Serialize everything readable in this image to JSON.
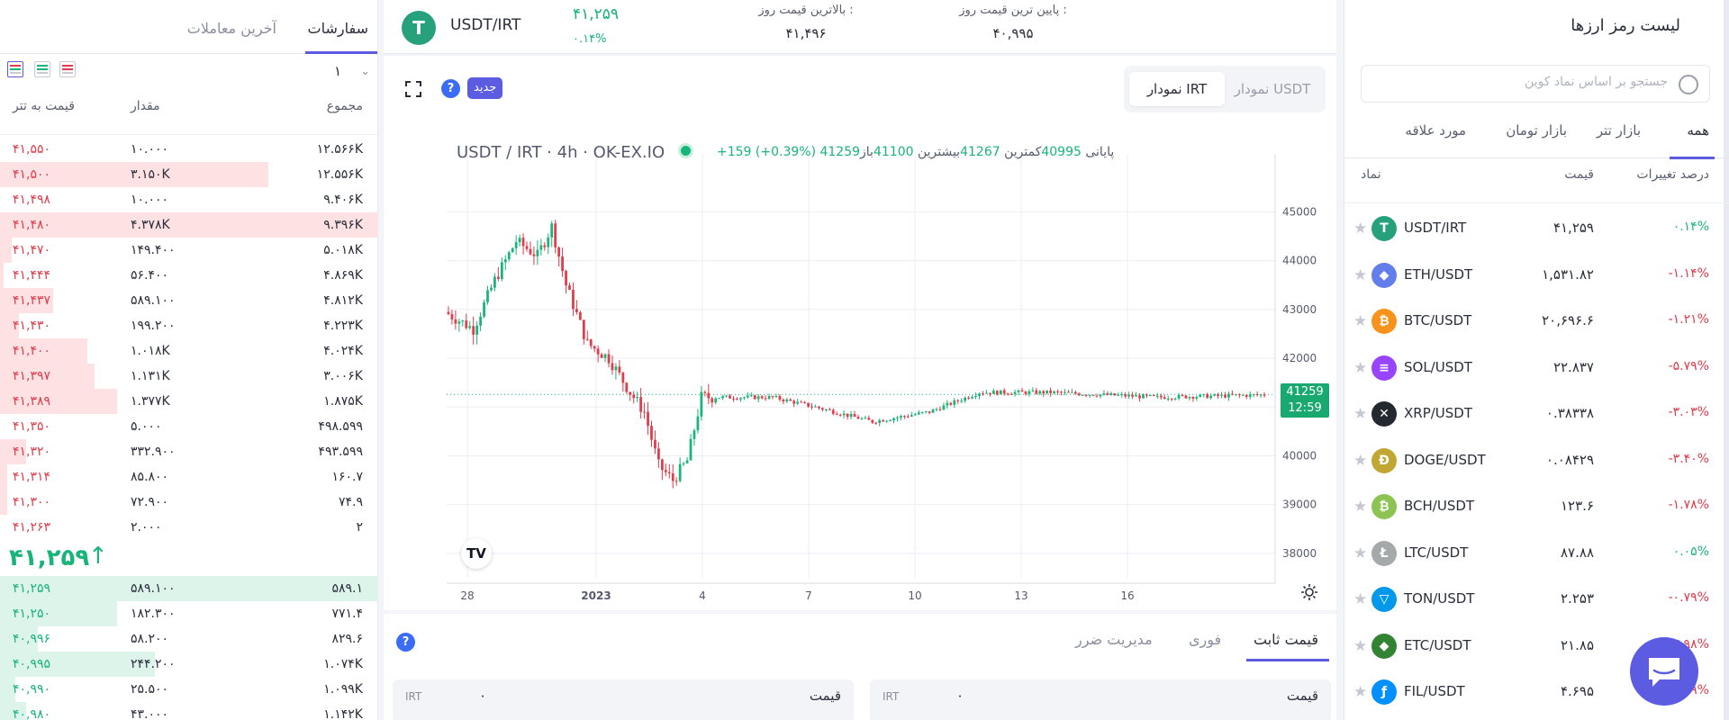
{
  "orderbook": {
    "tabs": [
      "سفارشات",
      "آخرین معاملات"
    ],
    "depth": "۱",
    "headers": {
      "total": "مجموع",
      "amount": "مقدار",
      "price": "قیمت به تتر"
    },
    "sells": [
      {
        "total": "۱۲.۵۶۶K",
        "amount": "۱۰.۰۰۰",
        "price": "۴۱,۵۵۰",
        "fill": 0
      },
      {
        "total": "۱۲.۵۵۶K",
        "amount": "۳.۱۵۰K",
        "price": "۴۱,۵۰۰",
        "fill": 0.71
      },
      {
        "total": "۹.۴۰۶K",
        "amount": "۱۰.۰۰۰",
        "price": "۴۱,۴۹۸",
        "fill": 0
      },
      {
        "total": "۹.۳۹۶K",
        "amount": "۴.۳۷۸K",
        "price": "۴۱,۴۸۰",
        "fill": 1
      },
      {
        "total": "۵.۰۱۸K",
        "amount": "۱۴۹.۴۰۰",
        "price": "۴۱,۴۷۰",
        "fill": 0.03
      },
      {
        "total": "۴.۸۶۹K",
        "amount": "۵۶.۴۰۰",
        "price": "۴۱,۴۴۴",
        "fill": 0.01
      },
      {
        "total": "۴.۸۱۲K",
        "amount": "۵۸۹.۱۰۰",
        "price": "۴۱,۴۳۷",
        "fill": 0.14
      },
      {
        "total": "۴.۲۲۳K",
        "amount": "۱۹۹.۲۰۰",
        "price": "۴۱,۴۳۰",
        "fill": 0.05
      },
      {
        "total": "۴.۰۲۴K",
        "amount": "۱.۰۱۸K",
        "price": "۴۱,۴۰۰",
        "fill": 0.23
      },
      {
        "total": "۳.۰۰۶K",
        "amount": "۱.۱۳۱K",
        "price": "۴۱,۳۹۷",
        "fill": 0.25
      },
      {
        "total": "۱.۸۷۵K",
        "amount": "۱.۳۷۷K",
        "price": "۴۱,۳۸۹",
        "fill": 0.31
      },
      {
        "total": "۴۹۸.۵۹۹",
        "amount": "۵.۰۰۰",
        "price": "۴۱,۳۵۰",
        "fill": 0
      },
      {
        "total": "۴۹۳.۵۹۹",
        "amount": "۳۳۲.۹۰۰",
        "price": "۴۱,۳۲۰",
        "fill": 0.07
      },
      {
        "total": "۱۶۰.۷",
        "amount": "۸۵.۸۰۰",
        "price": "۴۱,۳۱۴",
        "fill": 0.02
      },
      {
        "total": "۷۴.۹",
        "amount": "۷۲.۹۰۰",
        "price": "۴۱,۳۰۰",
        "fill": 0.02
      },
      {
        "total": "۲",
        "amount": "۲.۰۰۰",
        "price": "۴۱,۲۶۳",
        "fill": 0
      }
    ],
    "last_price": "۴۱,۲۵۹",
    "buys": [
      {
        "total": "۵۸۹.۱",
        "amount": "۵۸۹.۱۰۰",
        "price": "۴۱,۲۵۹",
        "fill": 1
      },
      {
        "total": "۷۷۱.۴",
        "amount": "۱۸۲.۳۰۰",
        "price": "۴۱,۲۵۰",
        "fill": 0.31
      },
      {
        "total": "۸۲۹.۶",
        "amount": "۵۸.۲۰۰",
        "price": "۴۰,۹۹۶",
        "fill": 0.1
      },
      {
        "total": "۱.۰۷۴K",
        "amount": "۲۴۴.۲۰۰",
        "price": "۴۰,۹۹۵",
        "fill": 0.41
      },
      {
        "total": "۱.۰۹۹K",
        "amount": "۲۵.۵۰۰",
        "price": "۴۰,۹۹۰",
        "fill": 0.04
      },
      {
        "total": "۱.۱۴۲K",
        "amount": "۴۳.۰۰۰",
        "price": "۴۰,۹۸۰",
        "fill": 0.07
      }
    ]
  },
  "ticker": {
    "pair": "USDT/IRT",
    "change_price": "۴۱,۲۵۹",
    "change_percent": "۰.۱۴%",
    "high_label": "بالاترین قیمت روز :",
    "high_value": "۴۱,۴۹۶",
    "low_label": "پایین ترین قیمت روز :",
    "low_value": "۴۰,۹۹۵"
  },
  "chart_panel": {
    "toggle": {
      "usdt": "نمودار USDT",
      "irt": "نمودار IRT"
    },
    "new_badge": "جدید",
    "help": "?",
    "legend": {
      "symbol": "USDT / IRT · 4h · OK-EX.IO",
      "open_label": "باز",
      "open": "41100",
      "high_label": "بیشترین",
      "high": "41267",
      "low_label": "کمترین",
      "low": "40995",
      "close_label": "پایانی",
      "close": "41259",
      "change": "+159 (+0.39%)"
    },
    "last_price_tag": "41259",
    "countdown": "12:59"
  },
  "chart_data": {
    "type": "candlestick",
    "title": "USDT / IRT · 4h · OK-EX.IO",
    "y_ticks": [
      38000,
      39000,
      40000,
      41000,
      42000,
      43000,
      44000,
      45000
    ],
    "ylim": [
      37500,
      45800
    ],
    "x_ticks": [
      "28",
      "2023",
      "4",
      "7",
      "10",
      "13",
      "16"
    ],
    "last_price": 41259,
    "colors": {
      "up": "#19b47a",
      "down": "#e23b4a"
    }
  },
  "order_form": {
    "tabs": [
      "قیمت ثابت",
      "فوری",
      "مدیریت ضرر"
    ],
    "help": "?",
    "fields": [
      {
        "label": "قیمت",
        "value": "۰",
        "unit": "IRT"
      },
      {
        "label": "قیمت",
        "value": "۰",
        "unit": "IRT"
      }
    ]
  },
  "market": {
    "title": "لیست رمز ارزها",
    "search_placeholder": "جستجو بر اساس نماد کوین",
    "tabs": [
      "همه",
      "بازار تتر",
      "بازار تومان",
      "مورد علاقه"
    ],
    "headers": {
      "change": "درصد تغییرات",
      "price": "قیمت",
      "symbol": "نماد"
    },
    "rows": [
      {
        "symbol": "USDT/IRT",
        "price": "۴۱,۲۵۹",
        "change": "۰.۱۴%",
        "dir": "up",
        "logo": "T",
        "color": "#26a17b"
      },
      {
        "symbol": "ETH/USDT",
        "price": "۱,۵۳۱.۸۲",
        "change": "-۱.۱۴%",
        "dir": "down",
        "logo": "◆",
        "color": "#627eea"
      },
      {
        "symbol": "BTC/USDT",
        "price": "۲۰,۶۹۶.۶",
        "change": "-۱.۲۱%",
        "dir": "down",
        "logo": "₿",
        "color": "#f7931a"
      },
      {
        "symbol": "SOL/USDT",
        "price": "۲۲.۸۳۷",
        "change": "-۵.۷۹%",
        "dir": "down",
        "logo": "≡",
        "color": "#9945ff"
      },
      {
        "symbol": "XRP/USDT",
        "price": "۰.۳۸۳۳۸",
        "change": "-۳.۰۳%",
        "dir": "down",
        "logo": "✕",
        "color": "#23292f"
      },
      {
        "symbol": "DOGE/USDT",
        "price": "۰.۰۸۴۲۹",
        "change": "-۳.۴۰%",
        "dir": "down",
        "logo": "Ð",
        "color": "#c2a633"
      },
      {
        "symbol": "BCH/USDT",
        "price": "۱۲۳.۶",
        "change": "-۱.۷۸%",
        "dir": "down",
        "logo": "₿",
        "color": "#8dc351"
      },
      {
        "symbol": "LTC/USDT",
        "price": "۸۷.۸۸",
        "change": "۰.۰۵%",
        "dir": "up",
        "logo": "Ł",
        "color": "#a6a9aa"
      },
      {
        "symbol": "TON/USDT",
        "price": "۲.۲۵۳",
        "change": "-۰.۷۹%",
        "dir": "down",
        "logo": "▽",
        "color": "#0098ea"
      },
      {
        "symbol": "ETC/USDT",
        "price": "۲۱.۸۵",
        "change": "-۳.۹۸%",
        "dir": "down",
        "logo": "◆",
        "color": "#328332"
      },
      {
        "symbol": "FIL/USDT",
        "price": "۴.۶۹۵",
        "change": "-۳.۵۹%",
        "dir": "down",
        "logo": "ƒ",
        "color": "#0090ff"
      }
    ]
  }
}
